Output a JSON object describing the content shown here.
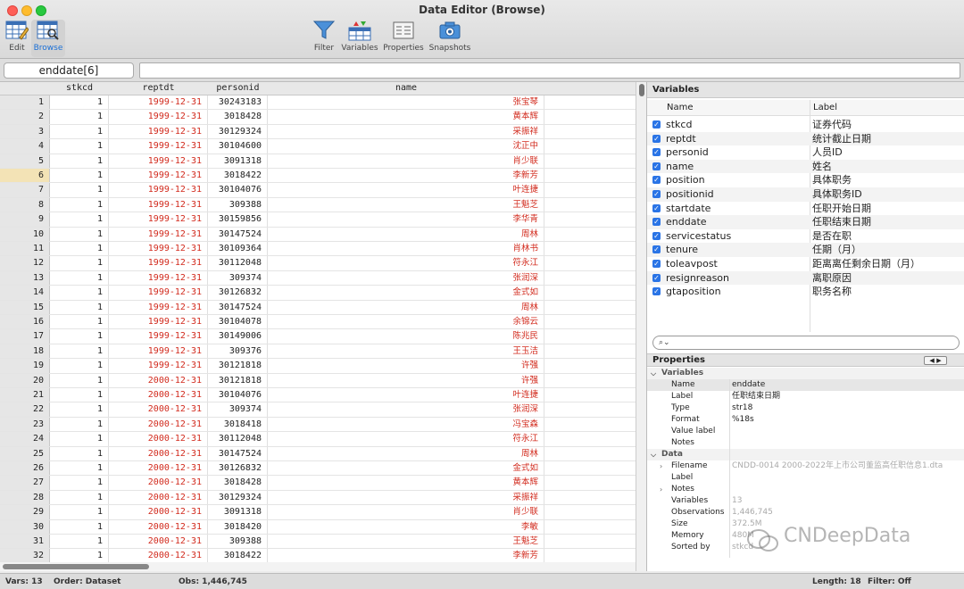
{
  "window": {
    "title": "Data Editor (Browse)"
  },
  "toolbar": {
    "edit": "Edit",
    "browse": "Browse",
    "filter": "Filter",
    "variables": "Variables",
    "properties": "Properties",
    "snapshots": "Snapshots"
  },
  "editbar": {
    "varname": "enddate[6]",
    "value": ""
  },
  "grid": {
    "columns": [
      "stkcd",
      "reptdt",
      "personid",
      "name"
    ],
    "selected_row": 6,
    "rows": [
      [
        "1",
        "1",
        "1999-12-31",
        "30243183",
        "张宝琴"
      ],
      [
        "2",
        "1",
        "1999-12-31",
        "3018428",
        "黄本辉"
      ],
      [
        "3",
        "1",
        "1999-12-31",
        "30129324",
        "采振祥"
      ],
      [
        "4",
        "1",
        "1999-12-31",
        "30104600",
        "沈正中"
      ],
      [
        "5",
        "1",
        "1999-12-31",
        "3091318",
        "肖少联"
      ],
      [
        "6",
        "1",
        "1999-12-31",
        "3018422",
        "李新芳"
      ],
      [
        "7",
        "1",
        "1999-12-31",
        "30104076",
        "叶连捷"
      ],
      [
        "8",
        "1",
        "1999-12-31",
        "309388",
        "王魁芝"
      ],
      [
        "9",
        "1",
        "1999-12-31",
        "30159856",
        "李华青"
      ],
      [
        "10",
        "1",
        "1999-12-31",
        "30147524",
        "周林"
      ],
      [
        "11",
        "1",
        "1999-12-31",
        "30109364",
        "肖林书"
      ],
      [
        "12",
        "1",
        "1999-12-31",
        "30112048",
        "符永江"
      ],
      [
        "13",
        "1",
        "1999-12-31",
        "309374",
        "张润深"
      ],
      [
        "14",
        "1",
        "1999-12-31",
        "30126832",
        "金式如"
      ],
      [
        "15",
        "1",
        "1999-12-31",
        "30147524",
        "周林"
      ],
      [
        "16",
        "1",
        "1999-12-31",
        "30104078",
        "余锦云"
      ],
      [
        "17",
        "1",
        "1999-12-31",
        "30149006",
        "陈兆民"
      ],
      [
        "18",
        "1",
        "1999-12-31",
        "309376",
        "王玉洁"
      ],
      [
        "19",
        "1",
        "1999-12-31",
        "30121818",
        "许强"
      ],
      [
        "20",
        "1",
        "2000-12-31",
        "30121818",
        "许强"
      ],
      [
        "21",
        "1",
        "2000-12-31",
        "30104076",
        "叶连捷"
      ],
      [
        "22",
        "1",
        "2000-12-31",
        "309374",
        "张润深"
      ],
      [
        "23",
        "1",
        "2000-12-31",
        "3018418",
        "冯宝森"
      ],
      [
        "24",
        "1",
        "2000-12-31",
        "30112048",
        "符永江"
      ],
      [
        "25",
        "1",
        "2000-12-31",
        "30147524",
        "周林"
      ],
      [
        "26",
        "1",
        "2000-12-31",
        "30126832",
        "金式如"
      ],
      [
        "27",
        "1",
        "2000-12-31",
        "3018428",
        "黄本辉"
      ],
      [
        "28",
        "1",
        "2000-12-31",
        "30129324",
        "采振祥"
      ],
      [
        "29",
        "1",
        "2000-12-31",
        "3091318",
        "肖少联"
      ],
      [
        "30",
        "1",
        "2000-12-31",
        "3018420",
        "李敏"
      ],
      [
        "31",
        "1",
        "2000-12-31",
        "309388",
        "王魁芝"
      ],
      [
        "32",
        "1",
        "2000-12-31",
        "3018422",
        "李新芳"
      ]
    ]
  },
  "variables_panel": {
    "title": "Variables",
    "col_name": "Name",
    "col_label": "Label",
    "items": [
      {
        "name": "stkcd",
        "label": "证券代码"
      },
      {
        "name": "reptdt",
        "label": "统计截止日期"
      },
      {
        "name": "personid",
        "label": "人员ID"
      },
      {
        "name": "name",
        "label": "姓名"
      },
      {
        "name": "position",
        "label": "具体职务"
      },
      {
        "name": "positionid",
        "label": "具体职务ID"
      },
      {
        "name": "startdate",
        "label": "任职开始日期"
      },
      {
        "name": "enddate",
        "label": "任职结束日期"
      },
      {
        "name": "servicestatus",
        "label": "是否在职"
      },
      {
        "name": "tenure",
        "label": "任期（月）"
      },
      {
        "name": "toleavpost",
        "label": "距离离任剩余日期（月）"
      },
      {
        "name": "resignreason",
        "label": "离职原因"
      },
      {
        "name": "gtaposition",
        "label": "职务名称"
      }
    ]
  },
  "properties_panel": {
    "title": "Properties",
    "variables_section": "Variables",
    "var_props": [
      {
        "key": "Name",
        "value": "enddate"
      },
      {
        "key": "Label",
        "value": "任职结束日期"
      },
      {
        "key": "Type",
        "value": "str18"
      },
      {
        "key": "Format",
        "value": "%18s"
      },
      {
        "key": "Value label",
        "value": ""
      },
      {
        "key": "Notes",
        "value": ""
      }
    ],
    "data_section": "Data",
    "data_props": [
      {
        "key": "Filename",
        "value": "CNDD-0014 2000-2022年上市公司董监高任职信息1.dta",
        "expandable": true
      },
      {
        "key": "Label",
        "value": ""
      },
      {
        "key": "Notes",
        "value": "",
        "expandable": true
      },
      {
        "key": "Variables",
        "value": "13"
      },
      {
        "key": "Observations",
        "value": "1,446,745"
      },
      {
        "key": "Size",
        "value": "372.5M"
      },
      {
        "key": "Memory",
        "value": "480M"
      },
      {
        "key": "Sorted by",
        "value": "stkcd"
      }
    ]
  },
  "watermark": "CNDeepData",
  "status": {
    "vars": "Vars: 13",
    "order": "Order: Dataset",
    "obs": "Obs: 1,446,745",
    "length": "Length: 18",
    "filter": "Filter: Off"
  }
}
